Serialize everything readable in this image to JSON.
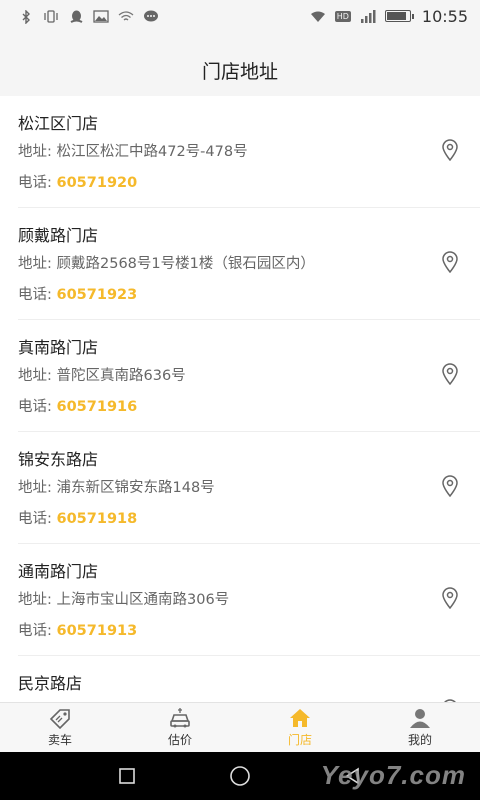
{
  "status_bar": {
    "time": "10:55",
    "left_icons": [
      "bluetooth-icon",
      "vibrate-icon",
      "qq-icon",
      "image-icon",
      "wifi-share-icon",
      "chat-icon"
    ],
    "right_icons": [
      "wifi-icon",
      "hd-icon",
      "signal-icon",
      "battery-icon"
    ],
    "hd_label": "HD",
    "battery_level": 0.9
  },
  "header": {
    "title": "门店地址"
  },
  "stores": [
    {
      "name": "松江区门店",
      "address_label": "地址:",
      "address": "松江区松汇中路472号-478号",
      "phone_label": "电话:",
      "phone": "60571920"
    },
    {
      "name": "顾戴路门店",
      "address_label": "地址:",
      "address": "顾戴路2568号1号楼1楼（银石园区内）",
      "phone_label": "电话:",
      "phone": "60571923"
    },
    {
      "name": "真南路门店",
      "address_label": "地址:",
      "address": "普陀区真南路636号",
      "phone_label": "电话:",
      "phone": "60571916"
    },
    {
      "name": "锦安东路店",
      "address_label": "地址:",
      "address": "浦东新区锦安东路148号",
      "phone_label": "电话:",
      "phone": "60571918"
    },
    {
      "name": "通南路门店",
      "address_label": "地址:",
      "address": "上海市宝山区通南路306号",
      "phone_label": "电话:",
      "phone": "60571913"
    },
    {
      "name": "民京路店",
      "address_label": "",
      "address": "",
      "phone_label": "",
      "phone": ""
    }
  ],
  "tabs": [
    {
      "label": "卖车",
      "icon": "tag-icon",
      "active": false
    },
    {
      "label": "估价",
      "icon": "car-estimate-icon",
      "active": false
    },
    {
      "label": "门店",
      "icon": "home-icon",
      "active": true
    },
    {
      "label": "我的",
      "icon": "user-icon",
      "active": false
    }
  ],
  "colors": {
    "accent": "#f5b92b",
    "header_bg": "#f5f5f5",
    "text_secondary": "#666666"
  },
  "watermark": "Yeyo7.com"
}
